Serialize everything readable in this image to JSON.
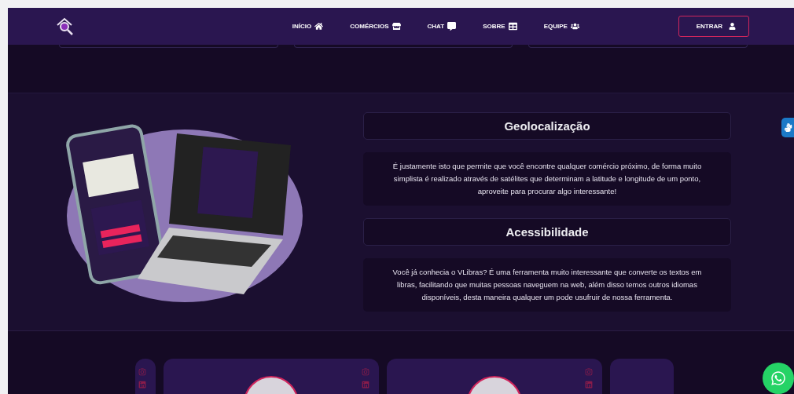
{
  "nav": {
    "items": [
      {
        "label": "INÍCIO",
        "kind": "home"
      },
      {
        "label": "COMÉRCIOS",
        "kind": "store"
      },
      {
        "label": "CHAT",
        "kind": "chat"
      },
      {
        "label": "SOBRE",
        "kind": "about"
      },
      {
        "label": "EQUIPE",
        "kind": "team"
      }
    ],
    "login_button": "ENTRAR"
  },
  "features": [
    {
      "title": "Geolocalização",
      "text": "É justamente isto que permite que você encontre qualquer comércio próximo, de forma muito simplista é realizado através de satélites que determinam a latitude e longitude de um ponto, aproveite para procurar algo interessante!"
    },
    {
      "title": "Acessibilidade",
      "text": "Você já conhecia o VLibras? É uma ferramenta muito interessante que converte os textos em libras, facilitando que muitas pessoas naveguem na web, além disso temos outros idiomas disponíveis, desta maneira qualquer um pode usufruir de nossa ferramenta."
    }
  ],
  "team_cards": [
    {
      "kind": "cut"
    },
    {
      "kind": "full"
    },
    {
      "kind": "full"
    },
    {
      "kind": "cut"
    }
  ]
}
